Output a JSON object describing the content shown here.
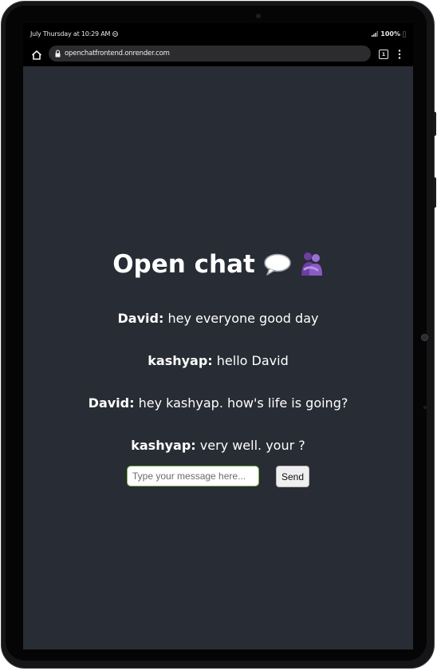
{
  "status": {
    "time": "July Thursday at 10:29 AM",
    "battery": "100%"
  },
  "browser": {
    "url": "openchatfrontend.onrender.com",
    "tab_count": "1"
  },
  "chat": {
    "title": "Open chat",
    "messages": [
      {
        "author": "David:",
        "text": "hey everyone good day"
      },
      {
        "author": "kashyap:",
        "text": "hello David"
      },
      {
        "author": "David:",
        "text": "hey kashyap. how's life is going?"
      },
      {
        "author": "kashyap:",
        "text": "very well. your ?"
      }
    ],
    "input": {
      "value": "",
      "placeholder": "Type your message here..."
    },
    "send_label": "Send"
  },
  "colors": {
    "background": "#282c34",
    "input_border": "#7ab648",
    "people_icon": "#8a5bc4"
  },
  "icons": {
    "title_icons": [
      "speech-bubble-icon",
      "people-hugging-icon"
    ]
  }
}
